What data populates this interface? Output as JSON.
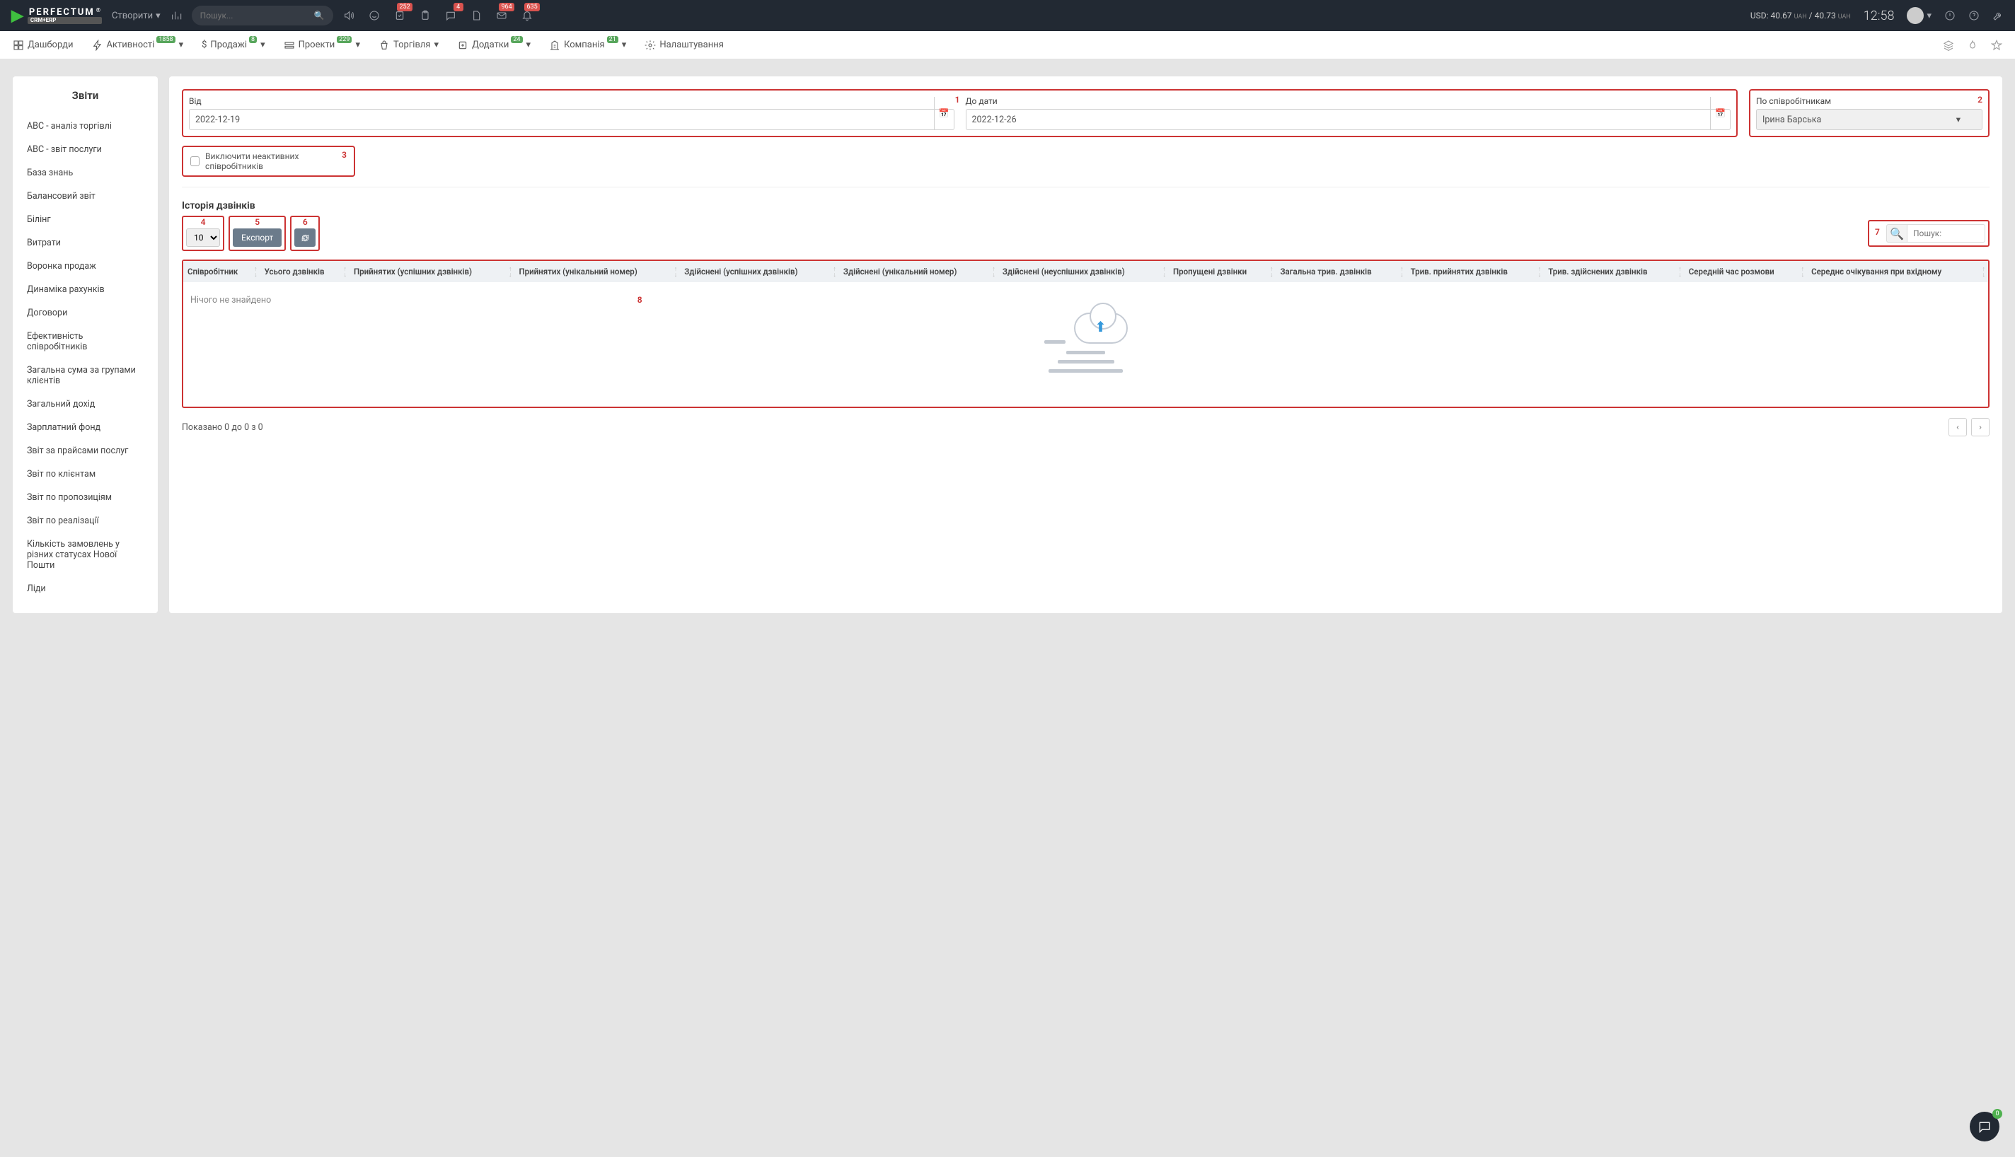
{
  "header": {
    "logo_text": "PERFECTUM",
    "logo_sub": "CRM+ERP",
    "logo_reg": "®",
    "create_label": "Створити",
    "search_placeholder": "Пошук...",
    "badges": {
      "tasks": "252",
      "docs": "4",
      "mail": "964",
      "bell": "635"
    },
    "currency_pre": "USD: 40.67",
    "currency_unit": "UAH",
    "currency_sep": " / 40.73",
    "clock": "12:58"
  },
  "menu": {
    "dash": "Дашборди",
    "activities": "Активності",
    "activities_badge": "1858",
    "sales": "Продажі",
    "sales_badge": "8",
    "projects": "Проекти",
    "projects_badge": "229",
    "trade": "Торгівля",
    "addons": "Додатки",
    "addons_badge": "24",
    "company": "Компанія",
    "company_badge": "21",
    "settings": "Налаштування"
  },
  "sidebar": {
    "title": "Звіти",
    "items": [
      "ABC - аналіз торгівлі",
      "ABC - звіт послуги",
      "База знань",
      "Балансовий звіт",
      "Білінг",
      "Витрати",
      "Воронка продаж",
      "Динаміка рахунків",
      "Договори",
      "Ефективність співробітників",
      "Загальна сума за групами клієнтів",
      "Загальний дохід",
      "Зарплатний фонд",
      "Звіт за прайсами послуг",
      "Звіт по клієнтам",
      "Звіт по пропозиціям",
      "Звіт по реалізації",
      "Кількість замовлень у різних статусах Нової Пошти",
      "Ліди"
    ]
  },
  "filters": {
    "from_label": "Від",
    "from_value": "2022-12-19",
    "to_label": "До дати",
    "to_value": "2022-12-26",
    "emp_label": "По співробітникам",
    "emp_value": "Ірина Барська",
    "exclude_label": "Виключити неактивних співробітників",
    "section_title": "Історія дзвінків",
    "page_size": "10",
    "export_label": "Експорт",
    "search_placeholder": "Пошук:"
  },
  "markers": {
    "m1": "1",
    "m2": "2",
    "m3": "3",
    "m4": "4",
    "m5": "5",
    "m6": "6",
    "m7": "7",
    "m8": "8"
  },
  "table": {
    "cols": [
      "Співробітник",
      "Усього дзвінків",
      "Прийнятих (успішних дзвінків)",
      "Прийнятих (унікальний номер)",
      "Здійснені (успішних дзвінків)",
      "Здійснені (унікальний номер)",
      "Здійснені (неуспішних дзвінків)",
      "Пропущені дзвінки",
      "Загальна трив. дзвінків",
      "Трив. прийнятих дзвінків",
      "Трив. здійснених дзвінків",
      "Середній час розмови",
      "Середнє очікування при вхідному"
    ],
    "empty": "Нічого не знайдено"
  },
  "footer": {
    "info": "Показано 0 до 0 з 0"
  },
  "fab_badge": "0"
}
